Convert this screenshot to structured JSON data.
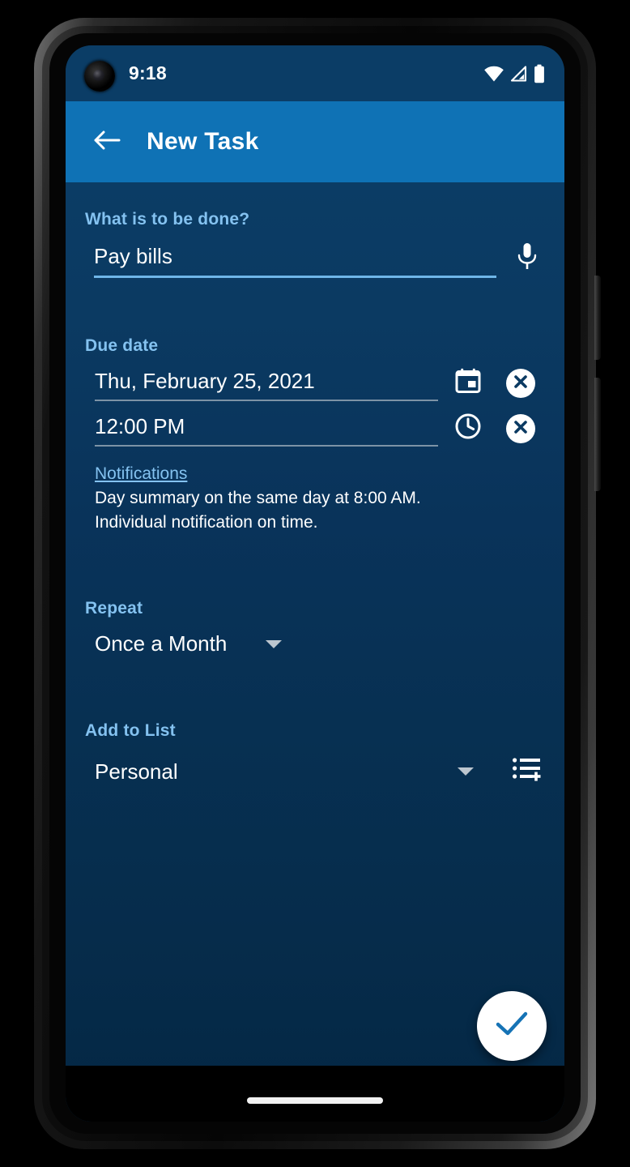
{
  "status_bar": {
    "time": "9:18",
    "icons": [
      "wifi-icon",
      "cellular-signal-icon",
      "battery-icon"
    ]
  },
  "app_bar": {
    "back_icon": "arrow-back-icon",
    "title": "New Task"
  },
  "task": {
    "label": "What is to be done?",
    "value": "Pay bills",
    "placeholder": "",
    "mic_icon": "microphone-icon"
  },
  "due_date": {
    "label": "Due date",
    "date_value": "Thu, February 25, 2021",
    "date_placeholder": "",
    "date_icon": "calendar-icon",
    "date_clear_icon": "clear-circle-icon",
    "time_value": "12:00 PM",
    "time_placeholder": "",
    "time_icon": "clock-icon",
    "time_clear_icon": "clear-circle-icon"
  },
  "notifications": {
    "link": "Notifications",
    "lines": [
      "Day summary on the same day at 8:00 AM.",
      "Individual notification on time."
    ]
  },
  "repeat": {
    "label": "Repeat",
    "value": "Once a Month",
    "caret_icon": "chevron-down-icon"
  },
  "add_to_list": {
    "label": "Add to List",
    "value": "Personal",
    "caret_icon": "chevron-down-icon",
    "new_list_icon": "playlist-add-icon"
  },
  "save": {
    "icon": "check-icon"
  },
  "colors": {
    "app_bar": "#0f72b5",
    "status_bar": "#0b3d66",
    "background_top": "#0b3c65",
    "background_bottom": "#042744",
    "label_blue": "#84c2f0",
    "accent_underline": "#6fb6e8",
    "fab_background": "#ffffff",
    "fab_check": "#1673b5"
  }
}
